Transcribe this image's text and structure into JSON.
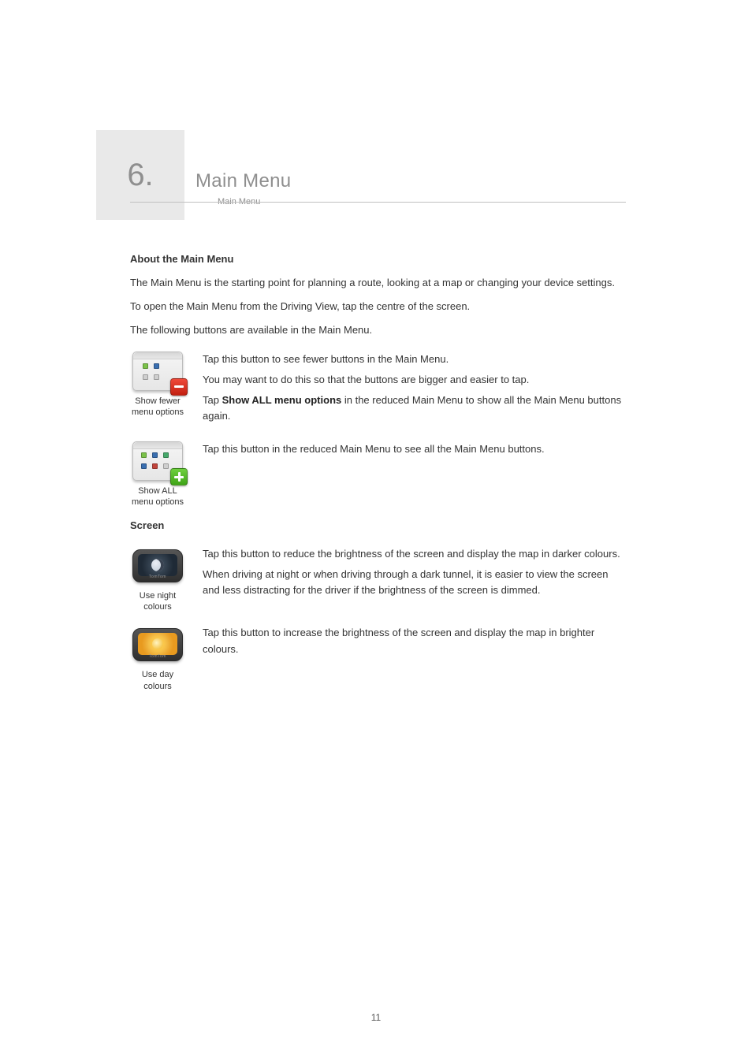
{
  "chapter": {
    "number": "6.",
    "title": "Main Menu",
    "subtitle": "Main Menu"
  },
  "section_about": {
    "heading": "About the Main Menu",
    "p1_a": "The Main Menu is the starting point for planning a route, looking at a map or changing your device settings.",
    "p2_a": "To open the Main Menu from the Driving View, tap the centre of the screen."
  },
  "section_buttons": {
    "lead_a": "The following buttons are available in the Main Menu.",
    "items": [
      {
        "caption": "Show fewer menu options",
        "icon": "grid-minus",
        "p1_a": "Tap this button to see fewer buttons in the Main Menu.",
        "p2_a": "You may want to do this so that the buttons are bigger and easier to tap.",
        "p3_a": "Tap ",
        "p3_b": "Show ALL menu options",
        "p3_c": " in the reduced Main Menu to show all the Main Menu buttons again."
      },
      {
        "caption": "Show ALL menu options",
        "icon": "grid-plus",
        "p1_a": "Tap this button in the reduced Main Menu to see all the Main Menu buttons."
      }
    ]
  },
  "section_screen": {
    "heading": "Screen",
    "items": [
      {
        "caption": "Use night colours",
        "icon": "device-night",
        "p1_a": "Tap this button to reduce the brightness of the screen and display the map in darker colours.",
        "p2_a": "When driving at night or when driving through a dark tunnel, it is easier to view the screen and less distracting for the driver if the brightness of the screen is dimmed."
      },
      {
        "caption": "Use day colours",
        "icon": "device-day",
        "p1_a": "Tap this button to increase the brightness of the screen and display the map in brighter colours."
      }
    ]
  },
  "colors": {
    "muted": "#8f8f8f",
    "text": "#333333",
    "badge_red": "#c21f10",
    "badge_green": "#3fa417"
  },
  "page_number": "11"
}
